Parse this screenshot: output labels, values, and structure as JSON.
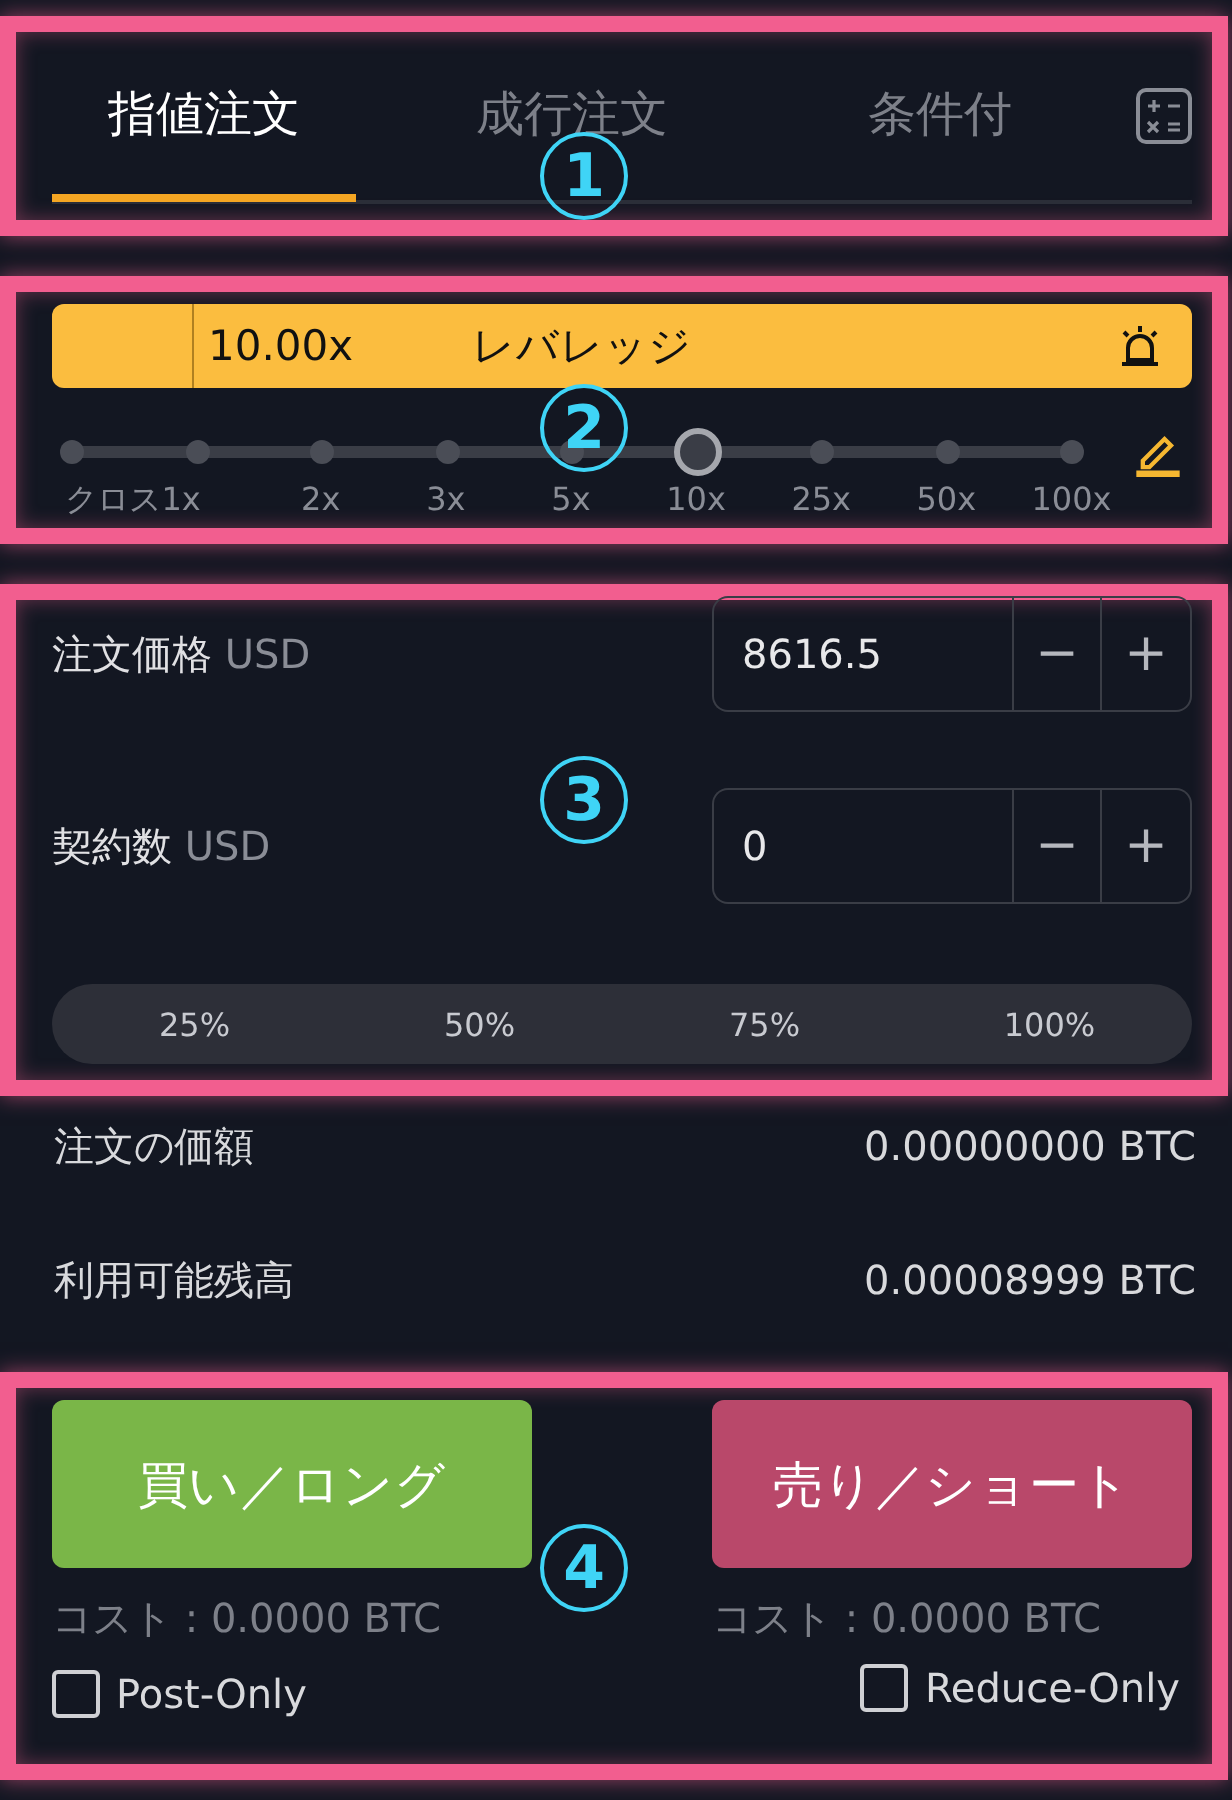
{
  "tabs": [
    {
      "label": "指値注文",
      "selected": true
    },
    {
      "label": "成行注文",
      "selected": false
    },
    {
      "label": "条件付",
      "selected": false
    }
  ],
  "leverage": {
    "value": "10.00x",
    "label": "レバレッジ",
    "level": 0.625,
    "ticks": [
      "クロス1x",
      "2x",
      "3x",
      "5x",
      "10x",
      "25x",
      "50x",
      "100x"
    ]
  },
  "inputs": [
    {
      "label": "注文価格",
      "unit": "USD",
      "value": "8616.5",
      "minus": "−",
      "plus": "+"
    },
    {
      "label": "契約数",
      "unit": "USD",
      "value": "0",
      "minus": "−",
      "plus": "+"
    }
  ],
  "percent_buttons": [
    "25%",
    "50%",
    "75%",
    "100%"
  ],
  "summary": [
    {
      "label": "注文の価額",
      "value": "0.00000000 BTC"
    },
    {
      "label": "利用可能残高",
      "value": "0.00008999 BTC"
    }
  ],
  "orders": [
    {
      "label": "買い／ロング",
      "kind": "buy",
      "cost": "コスト : 0.0000 BTC"
    },
    {
      "label": "売り／ショート",
      "kind": "sell",
      "cost": "コスト : 0.0000 BTC"
    }
  ],
  "options": [
    {
      "label": "Post-Only",
      "checked": false
    },
    {
      "label": "Reduce-Only",
      "checked": false
    }
  ],
  "callouts": [
    "1",
    "2",
    "3",
    "4"
  ]
}
